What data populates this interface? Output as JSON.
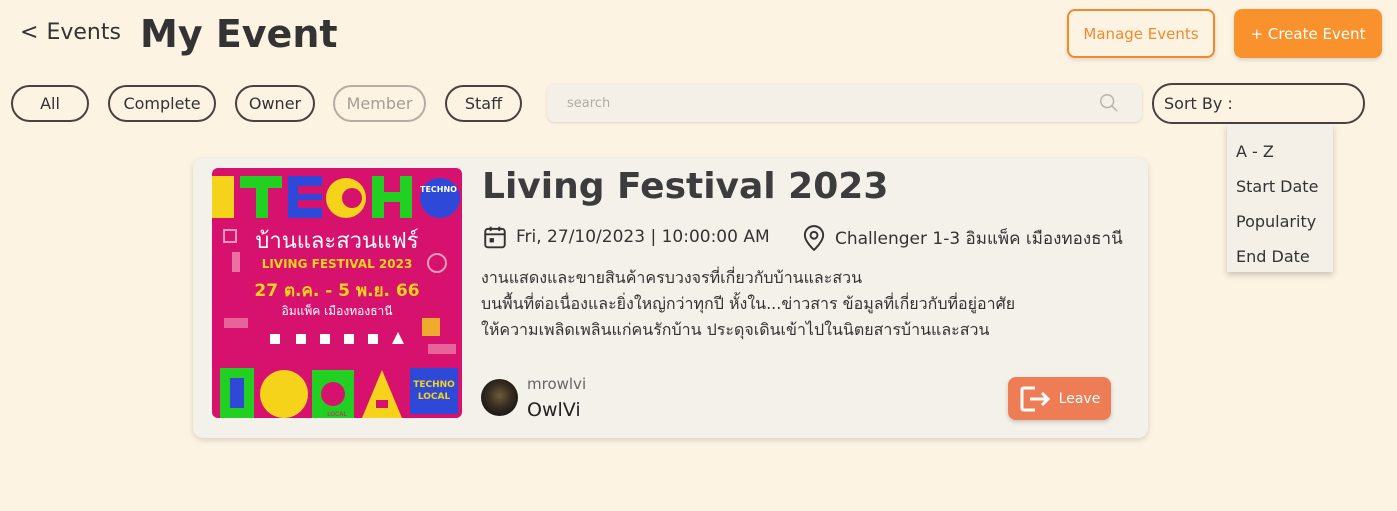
{
  "header": {
    "back_label": "Events",
    "back_chevron": "<",
    "title": "My Event",
    "manage_label": "Manage Events",
    "create_label": "+ Create Event"
  },
  "filters": [
    "All",
    "Complete",
    "Owner",
    "Member",
    "Staff"
  ],
  "search": {
    "placeholder": "search"
  },
  "sort": {
    "label": "Sort By :",
    "options": [
      "A - Z",
      "Start Date",
      "Popularity",
      "End Date"
    ]
  },
  "event": {
    "title": "Living Festival 2023",
    "date": "Fri, 27/10/2023 | 10:00:00 AM",
    "location": "Challenger 1-3 อิมแพ็ค เมืองทองธานี",
    "description": [
      "งานแสดงและขายสินค้าครบวงจรที่เกี่ยวกับบ้านและสวน",
      "บนพื้นที่ต่อเนื่องและยิ่งใหญ่กว่าทุกปี หั้งใน...ข่าวสาร ข้อมูลที่เกี่ยวกับที่อยู่อาศัย",
      "ให้ความเพลิดเพลินแก่คนรักบ้าน ประดุจเดินเข้าไปในนิตยสารบ้านและสวน"
    ],
    "owner_username": "mrowlvi",
    "owner_name": "OwlVi",
    "leave_label": "Leave",
    "poster": {
      "top_text": "TECHNO",
      "bottom_text": "LOCAL",
      "thai_title": "บ้านและสวนแฟร์",
      "subtitle": "LIVING FESTIVAL 2023",
      "dates": "27 ต.ค. - 5 พ.ย. 66",
      "venue": "อิมแพ็ค เมืองทองธานี",
      "badge_line1": "TECHNO",
      "badge_line2": "LOCAL"
    }
  },
  "colors": {
    "background": "#fdf3e3",
    "accent": "#f9922d",
    "leave": "#ee7c55",
    "poster_bg": "#d6126e"
  }
}
